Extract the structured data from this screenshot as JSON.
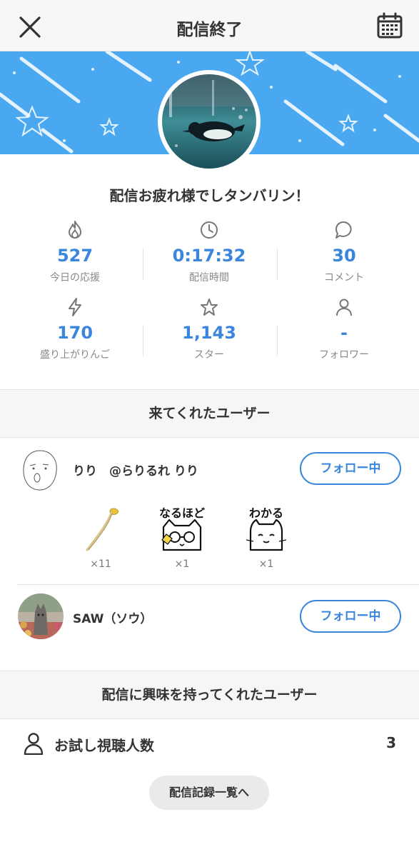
{
  "header": {
    "title": "配信終了",
    "close_icon": "close-icon",
    "calendar_icon": "calendar-icon"
  },
  "banner": {
    "color": "#49a8ef"
  },
  "message": "配信お疲れ様でしタンバリン！",
  "stats": [
    {
      "icon": "flame-icon",
      "value": "527",
      "label": "今日の応援"
    },
    {
      "icon": "clock-icon",
      "value": "0:17:32",
      "label": "配信時間"
    },
    {
      "icon": "comment-icon",
      "value": "30",
      "label": "コメント"
    },
    {
      "icon": "lightning-icon",
      "value": "170",
      "label": "盛り上がりんご"
    },
    {
      "icon": "star-icon",
      "value": "1,143",
      "label": "スター"
    },
    {
      "icon": "person-icon",
      "value": "-",
      "label": "フォロワー"
    }
  ],
  "visitors_section": {
    "title": "来てくれたユーザー",
    "users": [
      {
        "name": "りり　@らりるれ りり",
        "follow_label": "フォロー中",
        "gifts": [
          {
            "icon": "bean-sprout-icon",
            "count": "×11"
          },
          {
            "icon": "naruhodo-cat-icon",
            "text": "なるほど",
            "count": "×1"
          },
          {
            "icon": "wakaru-cat-icon",
            "text": "わかる",
            "count": "×1"
          }
        ]
      },
      {
        "name": "SAW（ソウ）",
        "follow_label": "フォロー中",
        "gifts": []
      }
    ]
  },
  "interested_section": {
    "title": "配信に興味を持ってくれたユーザー",
    "trial_label": "お試し視聴人数",
    "trial_count": "3"
  },
  "history_button": "配信記録一覧へ",
  "colors": {
    "accent": "#3b86dd",
    "section_bg": "#f4f6f7"
  }
}
